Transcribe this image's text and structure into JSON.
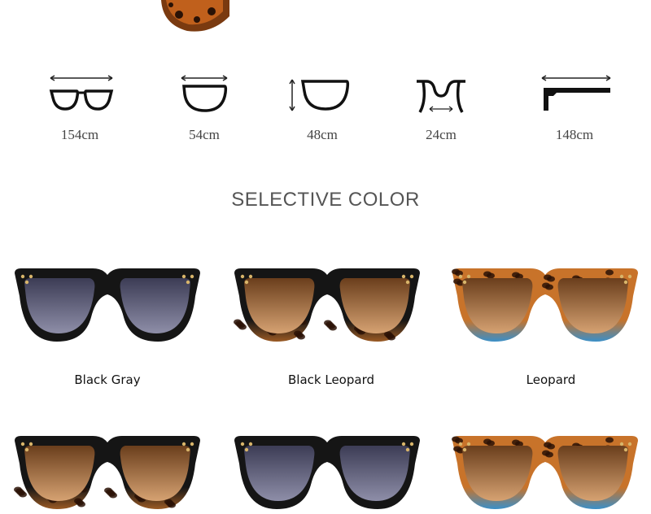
{
  "dimensions": {
    "total_width": "154cm",
    "lens_width": "54cm",
    "lens_height": "48cm",
    "bridge_width": "24cm",
    "temple_length": "148cm"
  },
  "section_title": "SELECTIVE COLOR",
  "colors": [
    {
      "label": "Black Gray",
      "frame": "#151515",
      "lens_top": "#3c3c55",
      "lens_bottom": "#8e8ea8",
      "bottom_accent": "#151515"
    },
    {
      "label": "Black Leopard",
      "frame": "#151515",
      "lens_top": "#6a3e1c",
      "lens_bottom": "#d6a272",
      "bottom_accent": "#9a5a24"
    },
    {
      "label": "Leopard",
      "frame": "#c8732a",
      "lens_top": "#6a3e1c",
      "lens_bottom": "#d6a272",
      "bottom_accent": "#3a8fc8"
    }
  ],
  "icons": [
    "glasses-front-icon",
    "lens-width-icon",
    "lens-height-icon",
    "bridge-icon",
    "temple-side-icon"
  ]
}
